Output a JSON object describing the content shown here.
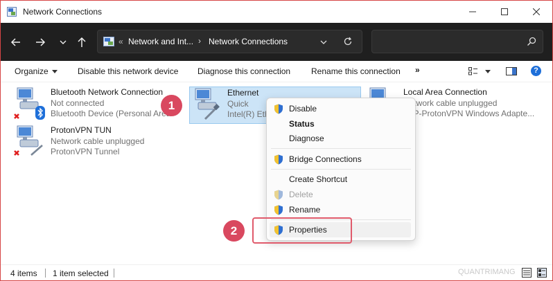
{
  "window": {
    "title": "Network Connections"
  },
  "address": {
    "overflow": "«",
    "crumbs": [
      "Network and Int...",
      "Network Connections"
    ],
    "separator": "›"
  },
  "search": {
    "placeholder": ""
  },
  "toolbar": {
    "organize": "Organize",
    "disable": "Disable this network device",
    "diagnose": "Diagnose this connection",
    "rename": "Rename this connection",
    "more": "»"
  },
  "connections": [
    {
      "name": "Bluetooth Network Connection",
      "status": "Not connected",
      "device": "Bluetooth Device (Personal Area"
    },
    {
      "name": "Ethernet",
      "status": "Quick",
      "device": "Intel(R) Eth"
    },
    {
      "name": "Local Area Connection",
      "status": "Network cable unplugged",
      "device": "TAP-ProtonVPN Windows Adapte..."
    },
    {
      "name": "ProtonVPN TUN",
      "status": "Network cable unplugged",
      "device": "ProtonVPN Tunnel"
    }
  ],
  "context_menu": {
    "items": [
      {
        "label": "Disable"
      },
      {
        "label": "Status"
      },
      {
        "label": "Diagnose"
      },
      {
        "label": "Bridge Connections"
      },
      {
        "label": "Create Shortcut"
      },
      {
        "label": "Delete"
      },
      {
        "label": "Rename"
      },
      {
        "label": "Properties"
      }
    ]
  },
  "annotations": {
    "step1": "1",
    "step2": "2"
  },
  "statusbar": {
    "count": "4 items",
    "selected": "1 item selected",
    "watermark": "QUANTRIMANG"
  },
  "colors": {
    "accent": "#1e6fd9",
    "selection": "#cce4f7",
    "annotation": "#d9485f",
    "dark_bar": "#1f1f1f"
  }
}
